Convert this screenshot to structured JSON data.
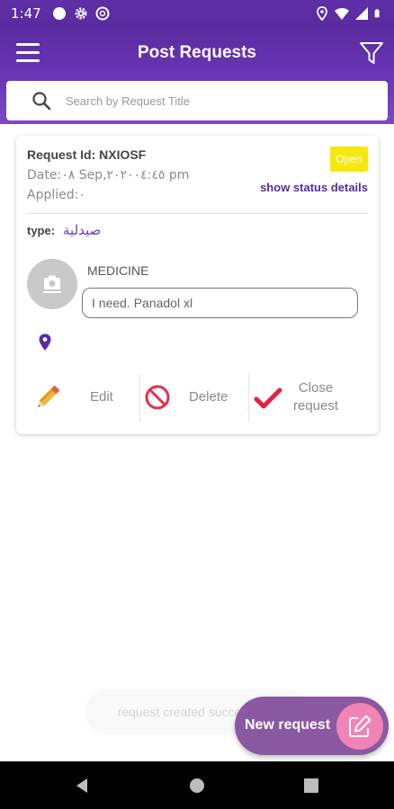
{
  "status_bar": {
    "time": "1:47",
    "left_icons": [
      "circle-icon",
      "gear-icon",
      "data-saver-icon"
    ],
    "right_icons": [
      "location-icon",
      "wifi-icon",
      "signal-icon",
      "battery-icon"
    ]
  },
  "app_bar": {
    "title": "Post Requests",
    "menu_icon": "menu-icon",
    "filter_icon": "filter-icon",
    "color": "#5a2ba0"
  },
  "search": {
    "placeholder": "Search by Request Title",
    "value": ""
  },
  "request_card": {
    "request_id_text": "Request Id: NXIOSF",
    "date_text": "Date:٠٨ Sep,٢٠٢٠٠٤:٤٥ pm",
    "applied_text": "Applied:٠",
    "status_badge": "Open",
    "status_badge_color": "#f5e70f",
    "status_link": "show status details",
    "type_label": "type:",
    "type_value": "صيدلية",
    "category": "MEDICINE",
    "description": "I need. Panadol xl",
    "actions": {
      "edit": "Edit",
      "delete": "Delete",
      "close_line1": "Close",
      "close_line2": "request"
    }
  },
  "toast": {
    "message": "request created successfully"
  },
  "fab": {
    "label": "New request",
    "icon": "edit-icon",
    "color": "#86539f",
    "icon_color": "#f07fb2"
  },
  "nav_bar": {
    "buttons": [
      "back-icon",
      "home-icon",
      "recents-icon"
    ]
  }
}
